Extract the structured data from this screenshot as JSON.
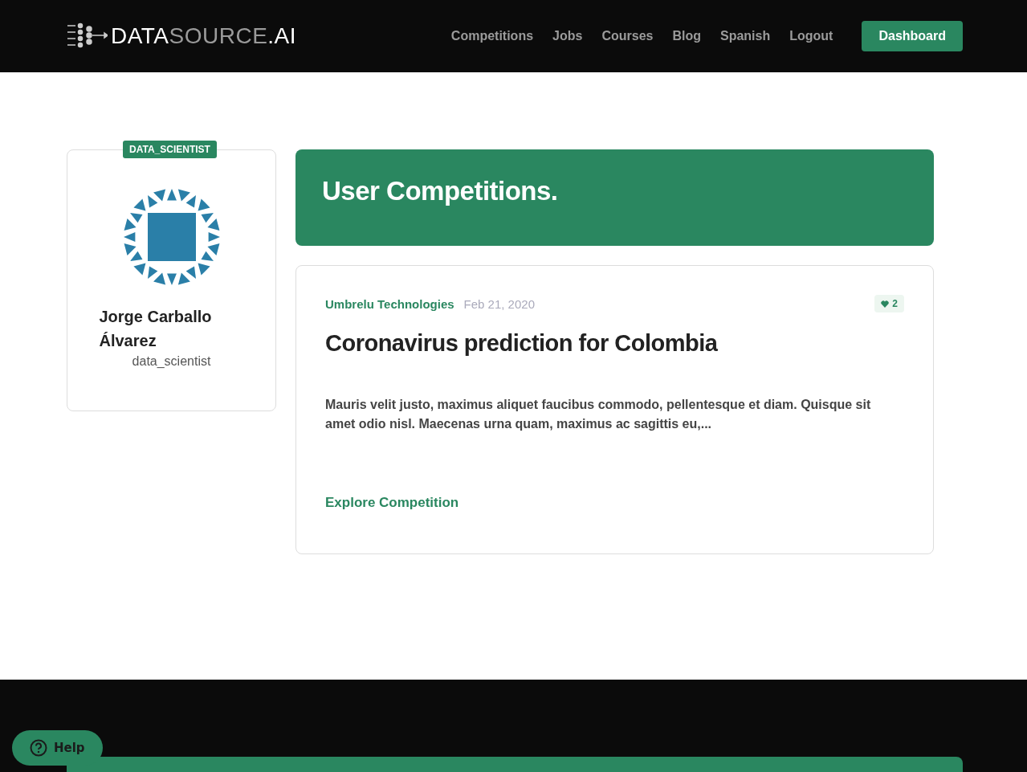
{
  "header": {
    "logo": [
      {
        "text": "DATA",
        "dim": false
      },
      {
        "text": "SOURCE",
        "dim": true
      },
      {
        "text": ".AI",
        "dim": false
      }
    ],
    "nav": [
      "Competitions",
      "Jobs",
      "Courses",
      "Blog",
      "Spanish",
      "Logout"
    ],
    "cta": "Dashboard"
  },
  "profile": {
    "badge": "DATA_SCIENTIST",
    "name": "Jorge Carballo Álvarez",
    "username": "data_scientist"
  },
  "banner": {
    "title": "User Competitions."
  },
  "competitions": [
    {
      "company": "Umbrelu Technologies",
      "date": "Feb 21, 2020",
      "likes": "2",
      "title": "Coronavirus prediction for Colombia",
      "description": "Mauris velit justo, maximus aliquet faucibus commodo, pellentesque et diam. Quisque sit amet odio nisl. Maecenas urna quam, maximus ac sagittis eu,...",
      "link": "Explore Competition"
    }
  ],
  "help": {
    "label": "Help"
  }
}
